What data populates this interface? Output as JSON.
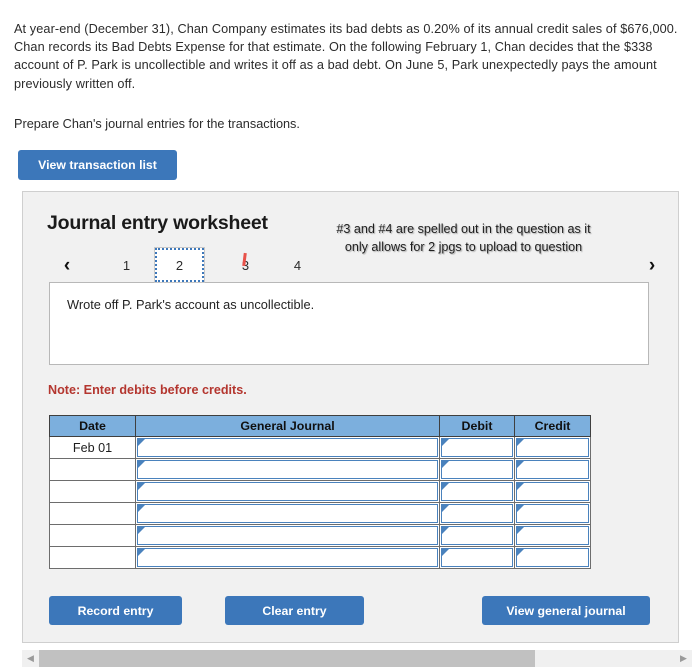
{
  "question": {
    "paragraph": "At year-end (December 31), Chan Company estimates its bad debts as 0.20% of its annual credit sales of $676,000. Chan records its Bad Debts Expense for that estimate. On the following February 1, Chan decides that the $338 account of P. Park is uncollectible and writes it off as a bad debt. On June 5, Park unexpectedly pays the amount previously written off.",
    "prompt": "Prepare Chan's journal entries for the transactions."
  },
  "toolbar": {
    "view_transaction_list_label": "View transaction list"
  },
  "worksheet": {
    "title": "Journal entry worksheet",
    "annotation": "#3 and #4 are spelled out in the question as it only allows for 2 jpgs to upload to question",
    "prev_icon": "‹",
    "next_icon": "›",
    "tabs": [
      {
        "label": "1",
        "selected": false,
        "struck": false
      },
      {
        "label": "2",
        "selected": true,
        "struck": false
      },
      {
        "label": "3",
        "selected": false,
        "struck": true
      },
      {
        "label": "4",
        "selected": false,
        "struck": false
      }
    ],
    "description": "Wrote off P. Park's account as uncollectible.",
    "note": "Note: Enter debits before credits."
  },
  "table": {
    "headers": [
      "Date",
      "General Journal",
      "Debit",
      "Credit"
    ],
    "rows": [
      {
        "date": "Feb 01",
        "general_journal": "",
        "debit": "",
        "credit": ""
      },
      {
        "date": "",
        "general_journal": "",
        "debit": "",
        "credit": ""
      },
      {
        "date": "",
        "general_journal": "",
        "debit": "",
        "credit": ""
      },
      {
        "date": "",
        "general_journal": "",
        "debit": "",
        "credit": ""
      },
      {
        "date": "",
        "general_journal": "",
        "debit": "",
        "credit": ""
      },
      {
        "date": "",
        "general_journal": "",
        "debit": "",
        "credit": ""
      }
    ]
  },
  "footer": {
    "record_entry_label": "Record entry",
    "clear_entry_label": "Clear entry",
    "view_general_journal_label": "View general journal"
  },
  "scrollbar": {
    "left_arrow_icon": "◀",
    "right_arrow_icon": "▶"
  },
  "colors": {
    "button_blue": "#3c77ba",
    "table_header_blue": "#7cafdd",
    "input_border_blue": "#4a82bd",
    "note_red": "#b4362f",
    "strike_red": "#e8524a",
    "panel_gray": "#f1f1f1"
  }
}
